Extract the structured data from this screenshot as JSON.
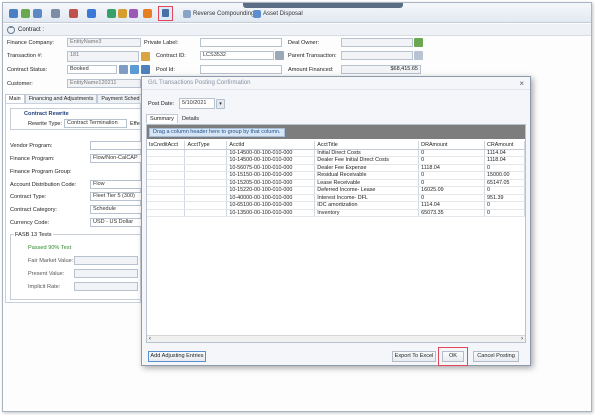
{
  "toolbar": {
    "reverse_compounding": "Reverse Compounding",
    "asset_disposal": "Asset Disposal"
  },
  "contract_header": {
    "label": "Contract :"
  },
  "form": {
    "finance_company_label": "Finance Company:",
    "finance_company_value": "EntityName3",
    "private_label_label": "Private Label:",
    "deal_owner_label": "Deal Owner:",
    "transaction_label": "Transaction #:",
    "transaction_value": "181",
    "contract_id_label": "Contract ID:",
    "contract_id_value": "LCS3532",
    "parent_transaction_label": "Parent Transaction:",
    "contract_status_label": "Contract Status:",
    "contract_status_value": "Booked",
    "pool_id_label": "Pool Id:",
    "amount_financed_label": "Amount Financed:",
    "amount_financed_value": "$68,415.65",
    "customer_label": "Customer:",
    "customer_value": "EntityName120211"
  },
  "left_tabs": [
    "Main",
    "Financing and Adjustments",
    "Payment Sched"
  ],
  "left": {
    "contract_rewrite_title": "Contract Rewrite",
    "rewrite_type_label": "Rewrite Type:",
    "rewrite_type_value": "Contract Termination",
    "effective_label": "Effe",
    "vendor_program_label": "Vendor Program:",
    "finance_program_label": "Finance Program:",
    "finance_program_value": "Flow/Non-CalCAP",
    "finance_program_group_label": "Finance Program Group:",
    "account_distribution_label": "Account Distribution Code:",
    "account_distribution_value": "Flow",
    "contract_type_label": "Contract Type:",
    "contract_type_value": "Fleet Tier 5 (300)",
    "contract_category_label": "Contract Category:",
    "contract_category_value": "Schedule",
    "currency_code_label": "Currency Code:",
    "currency_code_value": "USD - US Dollar",
    "fasb_title": "FASB 13 Tests",
    "fasb_passed": "Passed 90% Test",
    "fair_market_label": "Fair Market Value:",
    "present_value_label": "Present Value:",
    "implicit_rate_label": "Implicit Rate:"
  },
  "dialog": {
    "title": "G/L Transactions Posting Confirmation",
    "post_date_label": "Post Date:",
    "post_date_value": "5/10/2021",
    "tabs": [
      "Summary",
      "Details"
    ],
    "group_hint": "Drag a column header here to group by that column.",
    "columns": [
      "IsCreditAcct",
      "AcctType",
      "AcctId",
      "AcctTitle",
      "DRAmount",
      "CRAmount"
    ],
    "rows": [
      [
        "",
        "",
        "10-14500-00-100-010-000",
        "Initial Direct Costs",
        "0",
        "1114.04"
      ],
      [
        "",
        "",
        "10-14500-00-100-010-000",
        "Dealer Fee Initial Direct Costs",
        "0",
        "1118.04"
      ],
      [
        "",
        "",
        "10-56075-00-100-010-000",
        "Dealer Fee Expense",
        "1118.04",
        "0"
      ],
      [
        "",
        "",
        "10-15150-00-100-010-000",
        "Residual Receivable",
        "0",
        "15000.00"
      ],
      [
        "",
        "",
        "10-15205-00-100-010-000",
        "Lease Receivable",
        "0",
        "65147.05"
      ],
      [
        "",
        "",
        "10-15220-00-100-010-000",
        "Deferred Income- Lease",
        "16025.09",
        "0"
      ],
      [
        "",
        "",
        "10-40000-00-100-010-000",
        "Interest Income- DFL",
        "0",
        "951.39"
      ],
      [
        "",
        "",
        "10-65100-00-100-010-000",
        "IDC amortization",
        "1114.04",
        "0"
      ],
      [
        "",
        "",
        "10-13500-00-100-010-000",
        "Inventory",
        "65073.35",
        "0"
      ]
    ],
    "add_adjusting_entries": "Add Adjusting Entries",
    "export_to_excel": "Export To Excel",
    "ok": "OK",
    "cancel_posting": "Cancel Posting"
  }
}
